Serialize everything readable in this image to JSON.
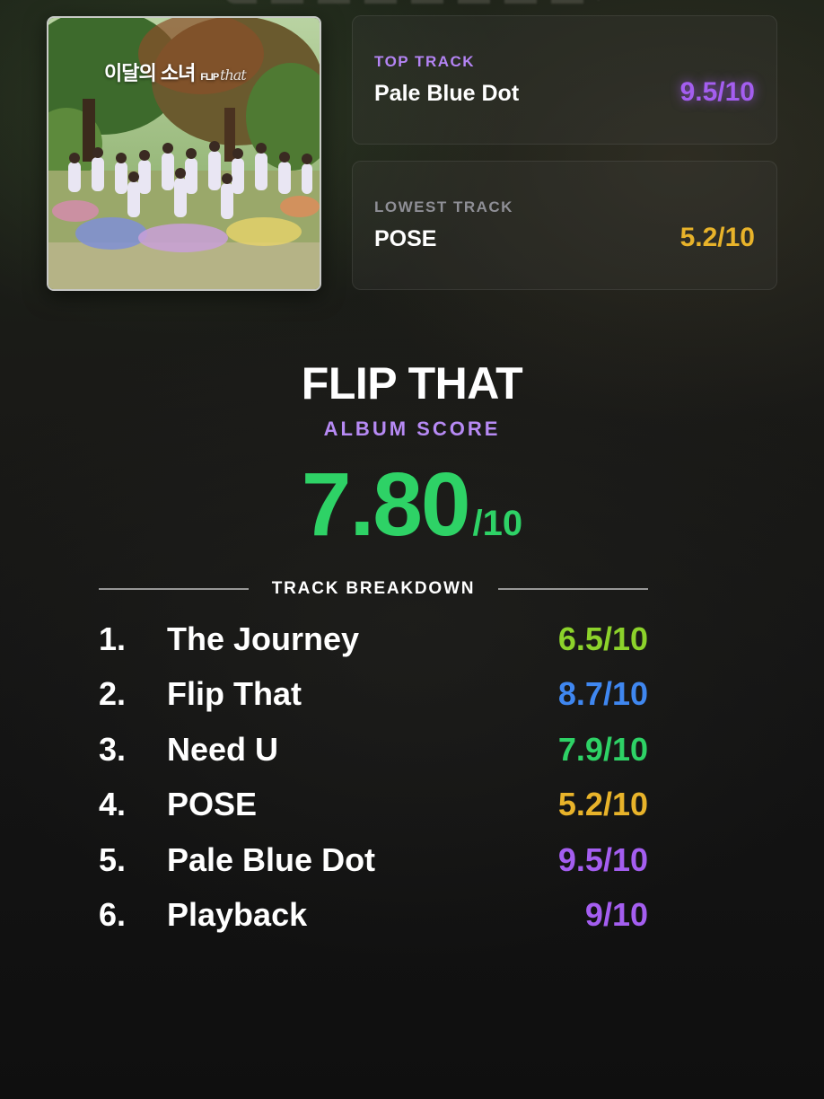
{
  "cover": {
    "title": "이달의 소녀",
    "subtitle_caps": "FLIP",
    "subtitle_script": "that"
  },
  "top_track": {
    "kicker": "TOP TRACK",
    "name": "Pale Blue Dot",
    "score": "9.5/10",
    "color": "#a45ef0"
  },
  "lowest_track": {
    "kicker": "LOWEST TRACK",
    "name": "POSE",
    "score": "5.2/10",
    "color": "#e8b32a"
  },
  "album": {
    "title": "FLIP THAT",
    "kicker": "ALBUM SCORE",
    "score": "7.80",
    "denominator": "/10",
    "color": "#2ed266"
  },
  "breakdown": {
    "label": "TRACK BREAKDOWN"
  },
  "tracks": [
    {
      "num": "1.",
      "name": "The Journey",
      "score": "6.5/10",
      "color": "#8cd22b"
    },
    {
      "num": "2.",
      "name": "Flip That",
      "score": "8.7/10",
      "color": "#3f87f0"
    },
    {
      "num": "3.",
      "name": "Need U",
      "score": "7.9/10",
      "color": "#2ed266"
    },
    {
      "num": "4.",
      "name": "POSE",
      "score": "5.2/10",
      "color": "#e8b32a"
    },
    {
      "num": "5.",
      "name": "Pale Blue Dot",
      "score": "9.5/10",
      "color": "#a45ef0"
    },
    {
      "num": "6.",
      "name": "Playback",
      "score": "9/10",
      "color": "#a45ef0"
    }
  ]
}
